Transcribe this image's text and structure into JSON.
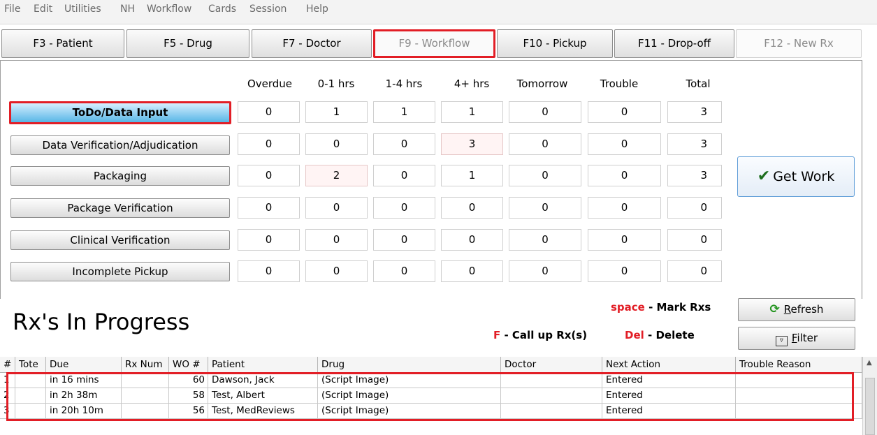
{
  "menu": [
    "File",
    "Edit",
    "Utilities",
    "NH",
    "Workflow",
    "Cards",
    "Session",
    "Help"
  ],
  "fkeys": {
    "patient": "F3 - Patient",
    "drug": "F5 - Drug",
    "doctor": "F7 - Doctor",
    "workflow": "F9 - Workflow",
    "pickup": "F10 - Pickup",
    "dropoff": "F11 - Drop-off",
    "newrx": "F12 - New Rx"
  },
  "columns": [
    "Overdue",
    "0-1 hrs",
    "1-4 hrs",
    "4+ hrs",
    "Tomorrow",
    "Trouble",
    "Total"
  ],
  "queues": [
    {
      "label": "ToDo/Data Input",
      "values": [
        "0",
        "1",
        "1",
        "1",
        "0",
        "0",
        "3"
      ]
    },
    {
      "label": "Data Verification/Adjudication",
      "values": [
        "0",
        "0",
        "0",
        "3",
        "0",
        "0",
        "3"
      ]
    },
    {
      "label": "Packaging",
      "values": [
        "0",
        "2",
        "0",
        "1",
        "0",
        "0",
        "3"
      ]
    },
    {
      "label": "Package Verification",
      "values": [
        "0",
        "0",
        "0",
        "0",
        "0",
        "0",
        "0"
      ]
    },
    {
      "label": "Clinical Verification",
      "values": [
        "0",
        "0",
        "0",
        "0",
        "0",
        "0",
        "0"
      ]
    },
    {
      "label": "Incomplete Pickup",
      "values": [
        "0",
        "0",
        "0",
        "0",
        "0",
        "0",
        "0"
      ]
    }
  ],
  "get_work": "Get Work",
  "progress": {
    "title": "Rx's In Progress",
    "legend": {
      "space_key": "space",
      "space_text": "Mark Rxs",
      "f_key": "F",
      "f_text": "Call up Rx(s)",
      "del_key": "Del",
      "del_text": "Delete"
    },
    "refresh_first": "R",
    "refresh_rest": "efresh",
    "filter_first": "F",
    "filter_rest": "ilter"
  },
  "grid": {
    "headers": [
      "#",
      "Tote",
      "Due",
      "Rx Num",
      "WO #",
      "Patient",
      "Drug",
      "Doctor",
      "Next Action",
      "Trouble Reason"
    ],
    "rows": [
      [
        "1",
        "",
        "in 16 mins",
        "",
        "60",
        "Dawson, Jack",
        "(Script Image)",
        "",
        "Entered",
        ""
      ],
      [
        "2",
        "",
        "in 2h 38m",
        "",
        "58",
        "Test, Albert",
        "(Script Image)",
        "",
        "Entered",
        ""
      ],
      [
        "3",
        "",
        "in 20h 10m",
        "",
        "56",
        "Test, MedReviews",
        "(Script Image)",
        "",
        "Entered",
        ""
      ]
    ]
  }
}
